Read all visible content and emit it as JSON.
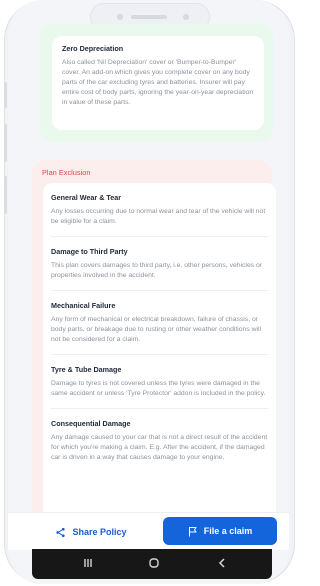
{
  "top_section": {
    "item_title": "Zero Depreciation",
    "item_text": "Also called 'Nil Depreciation' cover or 'Bumper-to-Bumper' cover. An add-on which gives you complete cover on any body parts of the car excluding tyres and batteries. Insurer will pay entire cost of body parts, ignoring the year-on-year depreciation in value of these parts."
  },
  "exclusion": {
    "title": "Plan Exclusion",
    "items": [
      {
        "title": "General Wear & Tear",
        "text": "Any losses occurring due to normal wear and tear of the vehicle will not be eligible for a claim."
      },
      {
        "title": "Damage to Third Party",
        "text": "This plan covers damages to third party, i.e. other persons, vehicles or properties involved in the accident."
      },
      {
        "title": "Mechanical Failure",
        "text": "Any form of mechanical or electrical breakdown, failure of chassis, or body parts, or breakage due to rusting or other weather conditions will not be considered for a claim."
      },
      {
        "title": "Tyre & Tube Damage",
        "text": "Damage to tyres is not covered unless the tyres were damaged in the same accident or unless 'Tyre Protector' addon is included in the policy."
      },
      {
        "title": "Consequential Damage",
        "text": "Any damage caused to your car that is not a direct result of the accident for which you're making a claim. E.g. After the accident, if the damaged car is driven in a way that causes damage to your engine."
      }
    ]
  },
  "actions": {
    "share_label": "Share Policy",
    "claim_label": "File a claim"
  },
  "icons": {
    "share": "share-icon",
    "flag": "flag-icon",
    "nav_recents": "recents-icon",
    "nav_home": "home-icon",
    "nav_back": "back-icon"
  },
  "colors": {
    "accent": "#1464dc",
    "exclusion_title": "#d64c4c",
    "green_panel": "#e9f9ee",
    "red_panel": "#fdeeee"
  }
}
